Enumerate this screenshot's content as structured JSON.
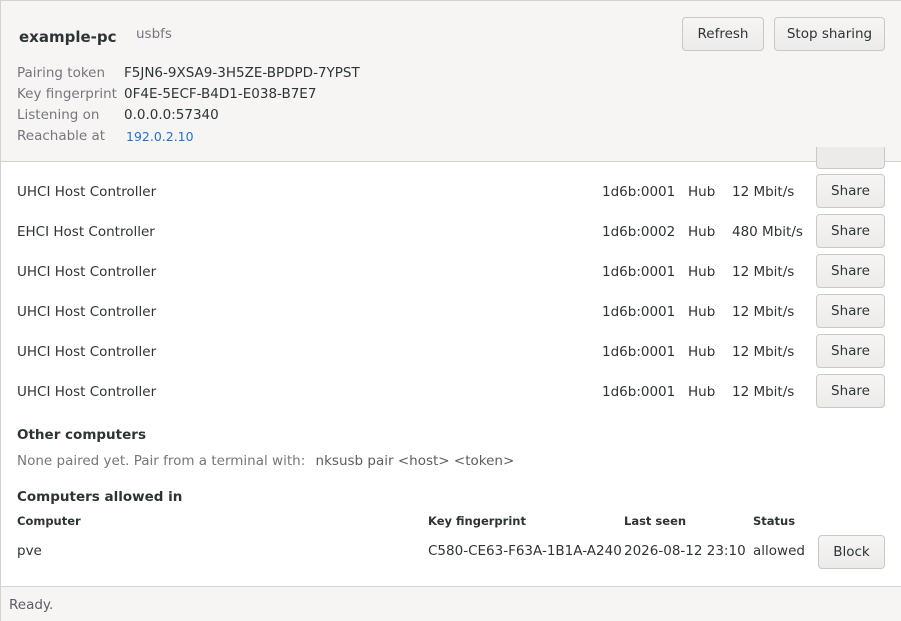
{
  "header": {
    "host_name": "example-pc",
    "fs_tag": "usbfs",
    "refresh_label": "Refresh",
    "stop_label": "Stop sharing",
    "info": [
      {
        "label": "Pairing token",
        "value": "F5JN6-9XSA9-3H5ZE-BPDPD-7YPST"
      },
      {
        "label": "Key fingerprint",
        "value": "0F4E-5ECF-B4D1-E038-B7E7"
      },
      {
        "label": "Listening on",
        "value": "0.0.0.0:57340"
      },
      {
        "label": "Reachable at",
        "value": "192.0.2.10"
      }
    ]
  },
  "devices": [
    {
      "name": "UHCI Host Controller",
      "id": "1d6b:0001",
      "type": "Hub",
      "speed": "12 Mbit/s",
      "action": "Share"
    },
    {
      "name": "EHCI Host Controller",
      "id": "1d6b:0002",
      "type": "Hub",
      "speed": "480 Mbit/s",
      "action": "Share"
    },
    {
      "name": "UHCI Host Controller",
      "id": "1d6b:0001",
      "type": "Hub",
      "speed": "12 Mbit/s",
      "action": "Share"
    },
    {
      "name": "UHCI Host Controller",
      "id": "1d6b:0001",
      "type": "Hub",
      "speed": "12 Mbit/s",
      "action": "Share"
    },
    {
      "name": "UHCI Host Controller",
      "id": "1d6b:0001",
      "type": "Hub",
      "speed": "12 Mbit/s",
      "action": "Share"
    },
    {
      "name": "UHCI Host Controller",
      "id": "1d6b:0001",
      "type": "Hub",
      "speed": "12 Mbit/s",
      "action": "Share"
    }
  ],
  "other_computers": {
    "title": "Other computers",
    "message": "None paired yet. Pair from a terminal with:",
    "command": "nksusb pair <host> <token>"
  },
  "allowed": {
    "title": "Computers allowed in",
    "columns": [
      "Computer",
      "Key fingerprint",
      "Last seen",
      "Status"
    ],
    "rows": [
      {
        "computer": "pve",
        "fingerprint": "C580-CE63-F63A-1B1A-A240",
        "last_seen": "2026-08-12 23:10",
        "status": "allowed",
        "action": "Block"
      }
    ]
  },
  "statusbar": {
    "text": "Ready."
  }
}
